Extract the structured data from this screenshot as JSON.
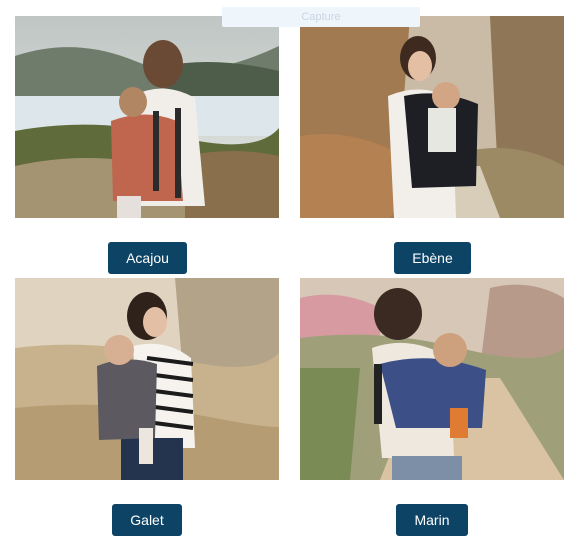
{
  "capture_overlay": "Capture",
  "products": [
    {
      "label": "Acajou",
      "accent": "#c0664f"
    },
    {
      "label": "Ebène",
      "accent": "#1d1f24"
    },
    {
      "label": "Galet",
      "accent": "#5c5a60"
    },
    {
      "label": "Marin",
      "accent": "#3c4f86"
    }
  ],
  "button_color": "#0d4466"
}
